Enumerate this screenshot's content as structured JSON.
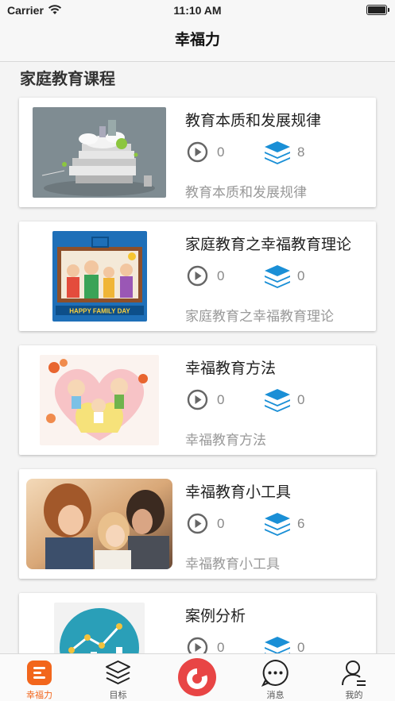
{
  "status_bar": {
    "carrier": "Carrier",
    "time": "11:10 AM"
  },
  "nav": {
    "title": "幸福力"
  },
  "section": {
    "title": "家庭教育课程"
  },
  "courses": [
    {
      "title": "教育本质和发展规律",
      "plays": "0",
      "lessons": "8",
      "subtitle": "教育本质和发展规律"
    },
    {
      "title": "家庭教育之幸福教育理论",
      "plays": "0",
      "lessons": "0",
      "subtitle": "家庭教育之幸福教育理论",
      "image_caption": "HAPPY FAMILY DAY"
    },
    {
      "title": "幸福教育方法",
      "plays": "0",
      "lessons": "0",
      "subtitle": "幸福教育方法"
    },
    {
      "title": "幸福教育小工具",
      "plays": "0",
      "lessons": "6",
      "subtitle": "幸福教育小工具"
    },
    {
      "title": "案例分析",
      "plays": "0",
      "lessons": "0",
      "subtitle": ""
    }
  ],
  "tabs": [
    {
      "label": "幸福力",
      "icon": "home-icon",
      "active": true
    },
    {
      "label": "目标",
      "icon": "layers-icon",
      "active": false
    },
    {
      "label": "",
      "icon": "center-logo-icon",
      "active": false
    },
    {
      "label": "消息",
      "icon": "message-icon",
      "active": false
    },
    {
      "label": "我的",
      "icon": "profile-icon",
      "active": false
    }
  ],
  "colors": {
    "accent": "#f2661c",
    "stat_blue": "#1a8fd6",
    "center_red": "#e84545"
  }
}
